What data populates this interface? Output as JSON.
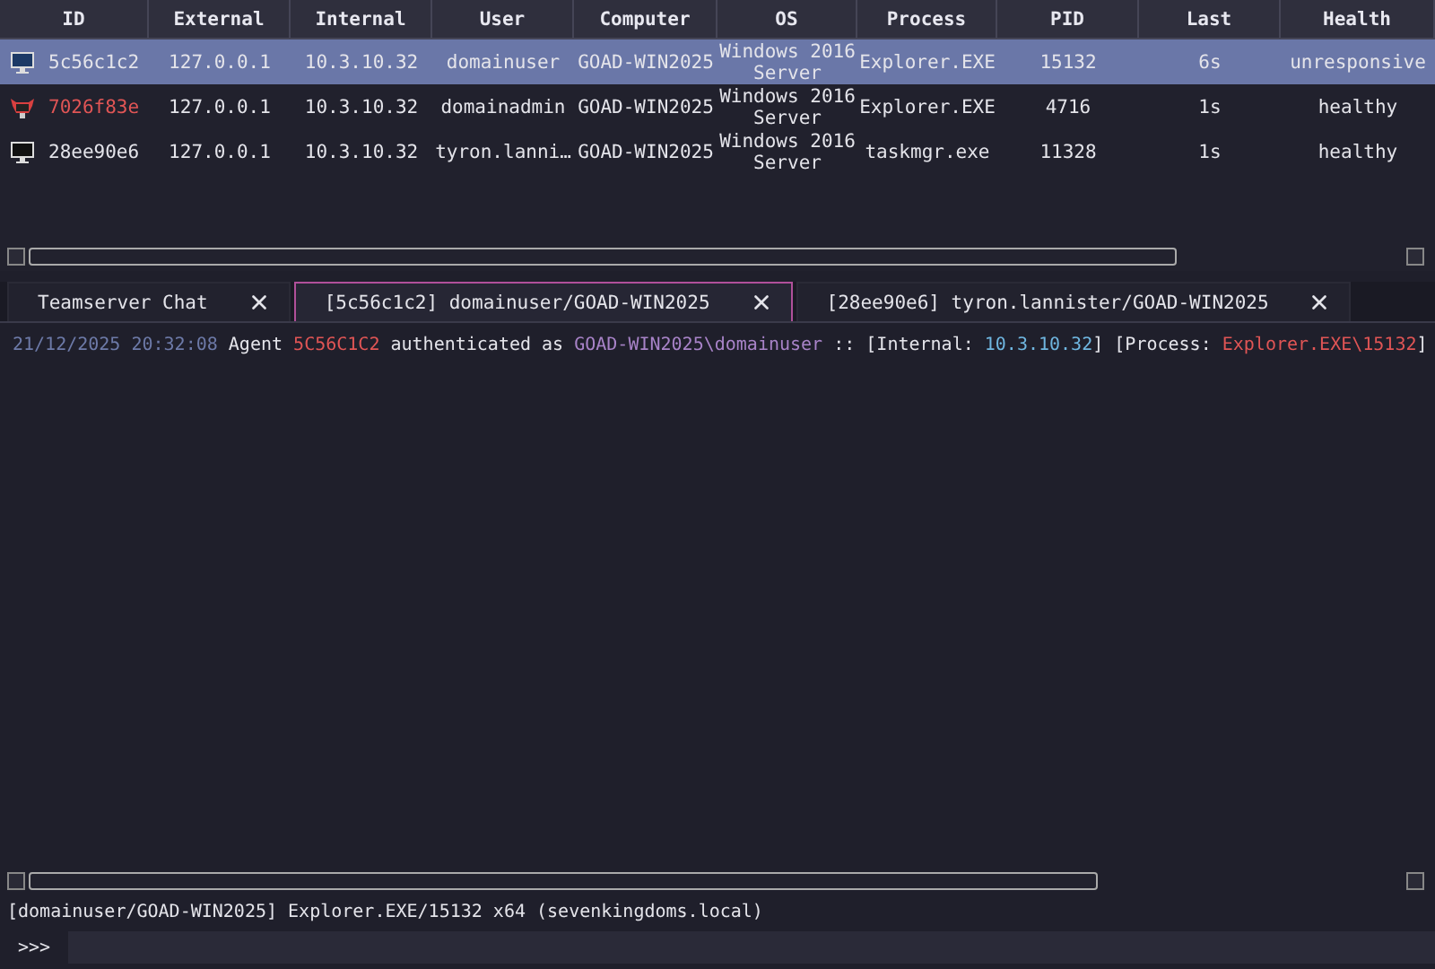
{
  "table": {
    "columns": [
      "ID",
      "External",
      "Internal",
      "User",
      "Computer",
      "OS",
      "Process",
      "PID",
      "Last",
      "Health"
    ],
    "rows": [
      {
        "selected": true,
        "elevated": false,
        "id": "5c56c1c2",
        "external": "127.0.0.1",
        "internal": "10.3.10.32",
        "user": "domainuser",
        "computer": "GOAD-WIN2025",
        "os": "Windows 2016 Server",
        "process": "Explorer.EXE",
        "pid": "15132",
        "last": "6s",
        "health": "unresponsive"
      },
      {
        "selected": false,
        "elevated": true,
        "id": "7026f83e",
        "external": "127.0.0.1",
        "internal": "10.3.10.32",
        "user": "domainadmin",
        "computer": "GOAD-WIN2025",
        "os": "Windows 2016 Server",
        "process": "Explorer.EXE",
        "pid": "4716",
        "last": "1s",
        "health": "healthy"
      },
      {
        "selected": false,
        "elevated": false,
        "id": "28ee90e6",
        "external": "127.0.0.1",
        "internal": "10.3.10.32",
        "user": "tyron.lanni…",
        "computer": "GOAD-WIN2025",
        "os": "Windows 2016 Server",
        "process": "taskmgr.exe",
        "pid": "11328",
        "last": "1s",
        "health": "healthy"
      }
    ]
  },
  "tabs": [
    {
      "label": "Teamserver Chat",
      "selected": false
    },
    {
      "label": "[5c56c1c2] domainuser/GOAD-WIN2025",
      "selected": true
    },
    {
      "label": "[28ee90e6] tyron.lannister/GOAD-WIN2025",
      "selected": false
    }
  ],
  "console": {
    "lines": [
      [
        {
          "kind": "timestamp",
          "text": "21/12/2025 20:32:08"
        },
        {
          "kind": "plain",
          "text": " Agent "
        },
        {
          "kind": "agent",
          "text": "5C56C1C2"
        },
        {
          "kind": "plain",
          "text": " authenticated as "
        },
        {
          "kind": "host",
          "text": "GOAD-WIN2025\\domainuser"
        },
        {
          "kind": "plain",
          "text": " :: [Internal: "
        },
        {
          "kind": "ip",
          "text": "10.3.10.32"
        },
        {
          "kind": "plain",
          "text": "] [Process: "
        },
        {
          "kind": "agent",
          "text": "Explorer.EXE\\15132"
        },
        {
          "kind": "plain",
          "text": "]"
        }
      ]
    ]
  },
  "status_bar": "[domainuser/GOAD-WIN2025] Explorer.EXE/15132 x64 (sevenkingdoms.local)",
  "prompt": ">>>"
}
